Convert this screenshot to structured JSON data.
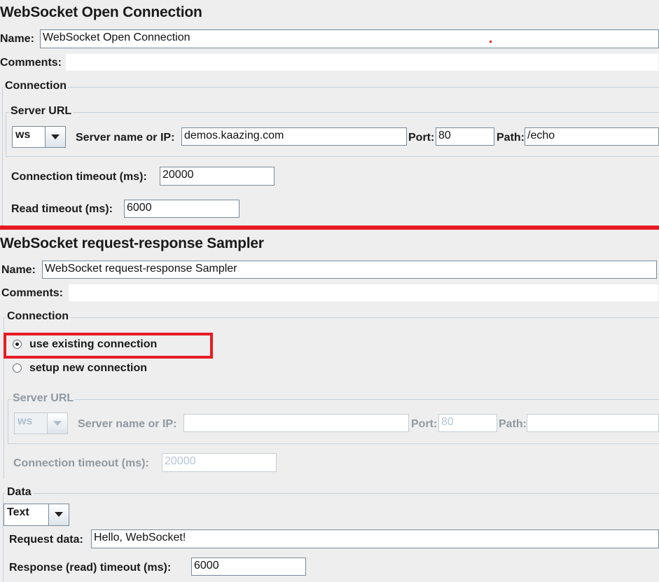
{
  "open_conn": {
    "title": "WebSocket Open Connection",
    "name_label": "Name:",
    "name_value": "WebSocket Open Connection",
    "comments_label": "Comments:",
    "connection_legend": "Connection",
    "server_url_legend": "Server URL",
    "protocol_value": "ws",
    "server_label": "Server name or IP:",
    "server_value": "demos.kaazing.com",
    "port_label": "Port:",
    "port_value": "80",
    "path_label": "Path:",
    "path_value": "/echo",
    "conn_timeout_label": "Connection timeout (ms):",
    "conn_timeout_value": "20000",
    "read_timeout_label": "Read timeout (ms):",
    "read_timeout_value": "6000"
  },
  "sampler": {
    "title": "WebSocket request-response Sampler",
    "name_label": "Name:",
    "name_value": "WebSocket request-response Sampler",
    "comments_label": "Comments:",
    "connection_legend": "Connection",
    "use_existing_label": "use existing connection",
    "setup_new_label": "setup new connection",
    "server_url_legend": "Server URL",
    "protocol_value": "ws",
    "server_label": "Server name or IP:",
    "server_value": "",
    "port_label": "Port:",
    "port_value": "80",
    "path_label": "Path:",
    "path_value": "",
    "conn_timeout_label": "Connection timeout (ms):",
    "conn_timeout_value": "20000",
    "data_legend": "Data",
    "data_type_value": "Text",
    "request_label": "Request data:",
    "request_value": "Hello, WebSocket!",
    "response_timeout_label": "Response (read) timeout (ms):",
    "response_timeout_value": "6000"
  },
  "colors": {
    "highlight": "#e61c24",
    "panel_bg": "#eeeeee",
    "disabled_text": "#b4c6d8"
  }
}
